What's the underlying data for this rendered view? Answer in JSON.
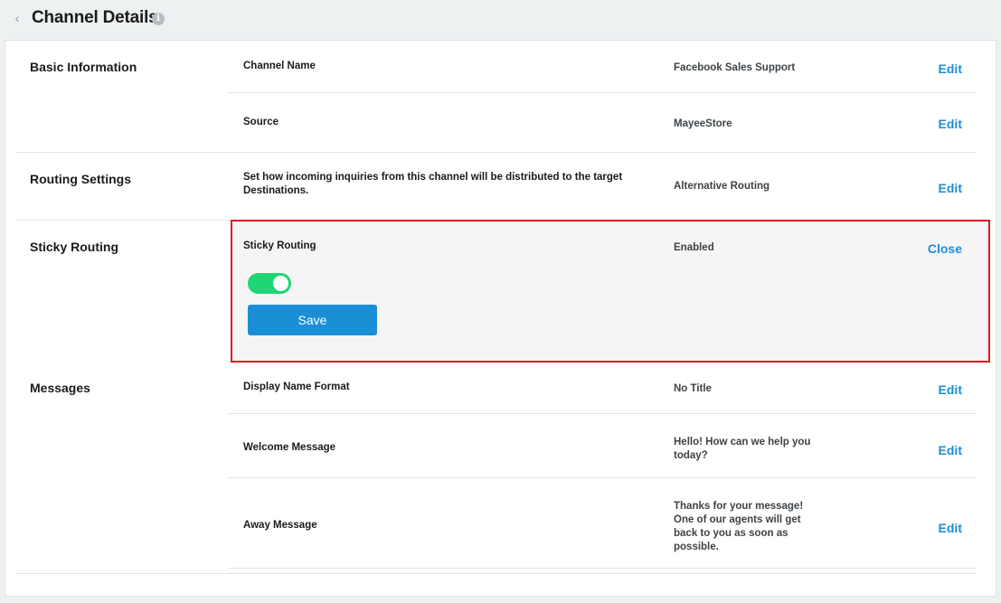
{
  "header": {
    "title": "Channel Details",
    "back_icon": "chevron-left-icon",
    "info_icon": "info-icon",
    "info_glyph": "i"
  },
  "sections": {
    "basic": {
      "title": "Basic Information",
      "channel_name": {
        "label": "Channel Name",
        "value": "Facebook Sales Support",
        "action": "Edit"
      },
      "source": {
        "label": "Source",
        "value": "MayeeStore",
        "action": "Edit"
      }
    },
    "routing": {
      "title": "Routing Settings",
      "description_line1": "Set how incoming inquiries from this channel will be distributed to the target",
      "description_line2": "Destinations.",
      "value": "Alternative Routing",
      "action": "Edit"
    },
    "sticky": {
      "title": "Sticky Routing",
      "label": "Sticky Routing",
      "value": "Enabled",
      "action": "Close",
      "toggle_on": true,
      "save_label": "Save"
    },
    "messages": {
      "title": "Messages",
      "display_name": {
        "label": "Display Name Format",
        "value": "No Title",
        "action": "Edit"
      },
      "welcome": {
        "label": "Welcome Message",
        "value_line1": "Hello! How can we help you",
        "value_line2": "today?",
        "action": "Edit"
      },
      "away": {
        "label": "Away Message",
        "value_line1": "Thanks for your message!",
        "value_line2": "One of our agents will get",
        "value_line3": "back to you as soon as",
        "value_line4": "possible.",
        "action": "Edit"
      }
    }
  },
  "colors": {
    "accent": "#1a8fd6",
    "toggle_on": "#1dd777",
    "highlight_border": "#e0181e"
  }
}
